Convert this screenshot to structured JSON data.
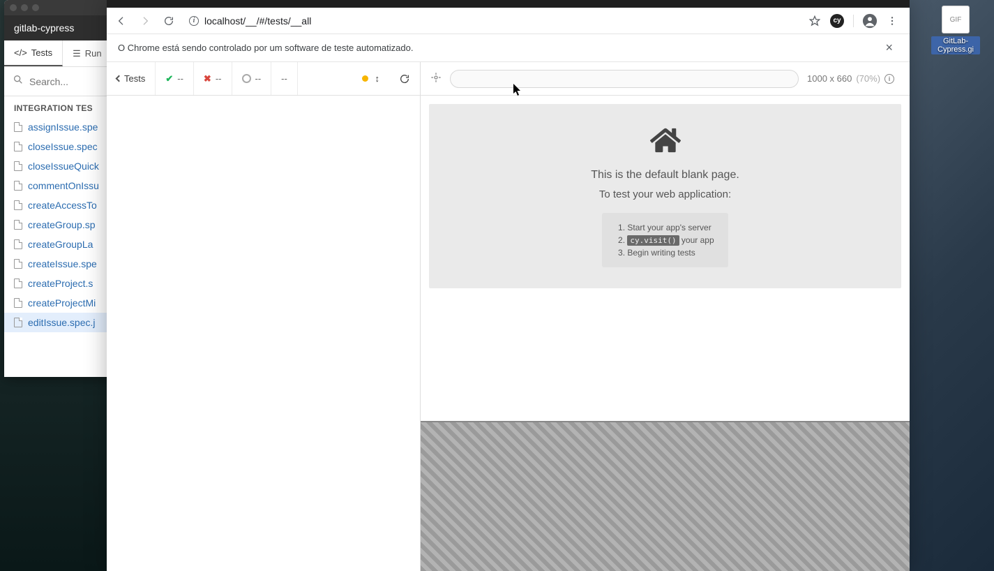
{
  "desktop": {
    "file_label": "GitLab-Cypress.gi",
    "file_type": "GIF"
  },
  "cypress_window": {
    "title": "gitlab-cypress",
    "tabs": {
      "tests": "Tests",
      "runs": "Run"
    },
    "search_placeholder": "Search...",
    "section_title": "INTEGRATION TES",
    "files": [
      "assignIssue.spe",
      "closeIssue.spec",
      "closeIssueQuick",
      "commentOnIssu",
      "createAccessTo",
      "createGroup.sp",
      "createGroupLa",
      "createIssue.spe",
      "createProject.s",
      "createProjectMi",
      "editIssue.spec.j"
    ]
  },
  "chrome": {
    "url": "localhost/__/#/tests/__all",
    "automation_msg": "O Chrome está sendo controlado por um software de teste automatizado.",
    "ext_label": "cy"
  },
  "runner": {
    "back_label": "Tests",
    "pass": "--",
    "fail": "--",
    "pending": "--",
    "duration": "--",
    "viewport": {
      "dims": "1000 x 660",
      "pct": "(70%)"
    },
    "blank": {
      "title": "This is the default blank page.",
      "subtitle": "To test your web application:",
      "steps": {
        "s1": "Start your app's server",
        "s2_code": "cy.visit()",
        "s2_after": " your app",
        "s3": "Begin writing tests"
      }
    }
  }
}
